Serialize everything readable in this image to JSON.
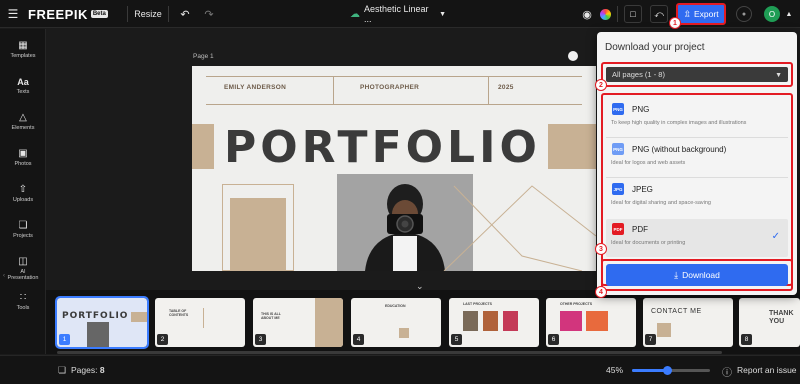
{
  "topbar": {
    "logo": "FREEPIK",
    "beta": "Beta",
    "resize": "Resize",
    "undo_icon": "undo-icon",
    "redo_icon": "redo-icon",
    "doc_title": "Aesthetic Linear ...",
    "export_label": "Export",
    "user_initial": "O"
  },
  "sidebar": {
    "items": [
      {
        "label": "Templates",
        "icon": "grid-icon"
      },
      {
        "label": "Texts",
        "icon": "text-icon"
      },
      {
        "label": "Elements",
        "icon": "shapes-icon"
      },
      {
        "label": "Photos",
        "icon": "image-icon"
      },
      {
        "label": "Uploads",
        "icon": "upload-icon"
      },
      {
        "label": "Projects",
        "icon": "folder-icon"
      },
      {
        "label": "AI Presentation",
        "icon": "presentation-icon"
      },
      {
        "label": "Tools",
        "icon": "apps-icon"
      }
    ]
  },
  "canvas": {
    "page_label": "Page 1",
    "slide": {
      "name": "EMILY ANDERSON",
      "role": "PHOTOGRAPHER",
      "year": "2025",
      "title": "PORTFOLIO"
    }
  },
  "filmstrip": {
    "thumbs": [
      {
        "num": "1",
        "label": "PORTFOLIO"
      },
      {
        "num": "2",
        "label": "TABLE OF CONTENTS"
      },
      {
        "num": "3",
        "label": "THIS IS ALL ABOUT ME"
      },
      {
        "num": "4",
        "label": "EDUCATION"
      },
      {
        "num": "5",
        "label": "LAST PROJECTS"
      },
      {
        "num": "6",
        "label": "OTHER PROJECTS"
      },
      {
        "num": "7",
        "label": "CONTACT ME"
      },
      {
        "num": "8",
        "label": "THANK YOU"
      }
    ]
  },
  "statusbar": {
    "pages_label": "Pages:",
    "pages_count": "8",
    "zoom": "45%",
    "zoom_value": 0.45,
    "report": "Report an issue"
  },
  "export_popup": {
    "title": "Download your project",
    "pages_select": "All pages (1 - 8)",
    "formats": [
      {
        "name": "PNG",
        "desc": "To keep high quality in complex images and illustrations",
        "color": "#2f6bf0"
      },
      {
        "name": "PNG (without background)",
        "desc": "Ideal for logos and web assets",
        "color": "#2f6bf0"
      },
      {
        "name": "JPEG",
        "desc": "Ideal for digital sharing and space-saving",
        "color": "#2f6bf0"
      },
      {
        "name": "PDF",
        "desc": "Ideal for documents or printing",
        "color": "#e31b23",
        "selected": true
      }
    ],
    "download_label": "Download"
  },
  "badges": [
    "1",
    "2",
    "3",
    "4"
  ],
  "colors": {
    "accent": "#2f6bf0",
    "highlight": "#e31b23",
    "tan": "#c8b194"
  }
}
